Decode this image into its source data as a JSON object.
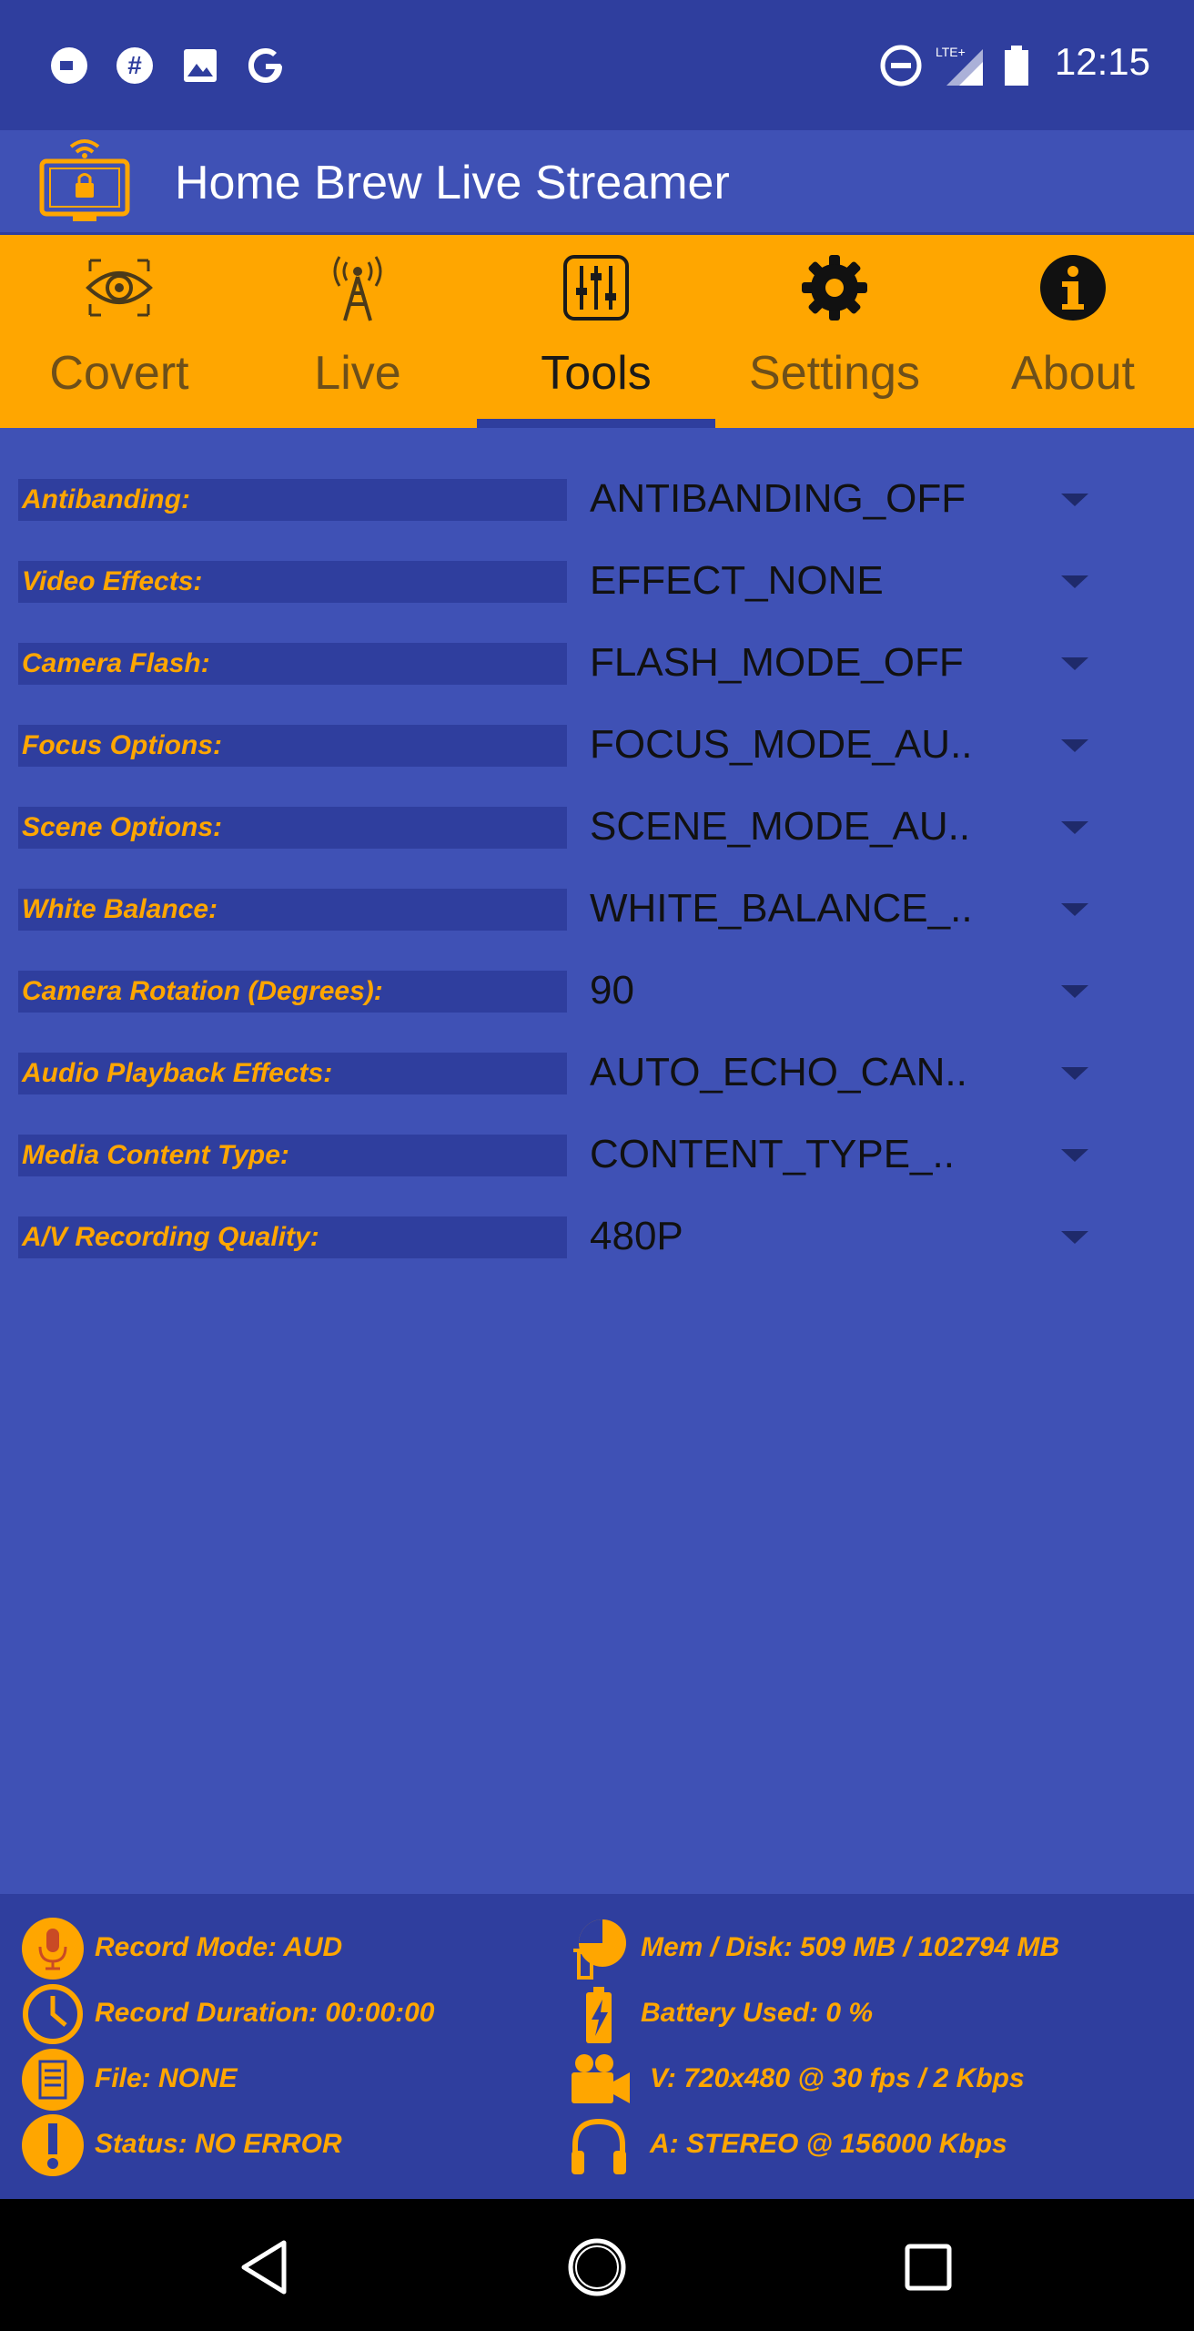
{
  "status_bar": {
    "time": "12:15",
    "left_icons": [
      "dot-circle-icon",
      "slack-icon",
      "image-icon",
      "google-icon"
    ],
    "right_icons": [
      "dnd-icon",
      "signal-lte-icon",
      "battery-icon"
    ],
    "network_label": "LTE+"
  },
  "app_bar": {
    "title": "Home Brew Live Streamer",
    "logo_icon": "tv-lock-wifi-icon"
  },
  "tabs": [
    {
      "label": "Covert",
      "icon": "eye-icon"
    },
    {
      "label": "Live",
      "icon": "antenna-icon"
    },
    {
      "label": "Tools",
      "icon": "sliders-icon",
      "active": true
    },
    {
      "label": "Settings",
      "icon": "gear-icon"
    },
    {
      "label": "About",
      "icon": "info-icon"
    }
  ],
  "settings": [
    {
      "label": "Antibanding:",
      "value": "ANTIBANDING_OFF"
    },
    {
      "label": "Video Effects:",
      "value": "EFFECT_NONE"
    },
    {
      "label": "Camera Flash:",
      "value": "FLASH_MODE_OFF"
    },
    {
      "label": "Focus Options:",
      "value": "FOCUS_MODE_AU.."
    },
    {
      "label": "Scene Options:",
      "value": "SCENE_MODE_AU.."
    },
    {
      "label": "White Balance:",
      "value": "WHITE_BALANCE_.."
    },
    {
      "label": "Camera Rotation (Degrees):",
      "value": "90"
    },
    {
      "label": "Audio Playback Effects:",
      "value": "AUTO_ECHO_CAN.."
    },
    {
      "label": "Media Content Type:",
      "value": "CONTENT_TYPE_.."
    },
    {
      "label": "A/V Recording Quality:",
      "value": "480P"
    }
  ],
  "info": {
    "left": [
      {
        "text": "Record Mode: AUD",
        "icon": "microphone-icon"
      },
      {
        "text": "Record Duration: 00:00:00",
        "icon": "clock-icon"
      },
      {
        "text": "File: NONE",
        "icon": "document-icon"
      },
      {
        "text": "Status: NO ERROR",
        "icon": "exclamation-icon"
      }
    ],
    "right": [
      {
        "text": "Mem / Disk: 509 MB / 102794 MB",
        "icon": "pie-chart-icon"
      },
      {
        "text": "Battery Used: 0 %",
        "icon": "battery-charging-icon"
      },
      {
        "text": "V: 720x480 @ 30 fps / 2 Kbps",
        "icon": "video-camera-icon"
      },
      {
        "text": "A: STEREO @ 156000 Kbps",
        "icon": "headphones-icon"
      }
    ]
  },
  "colors": {
    "primary": "#3f51b5",
    "primary_dark": "#2f3e9e",
    "accent": "#ffa600"
  }
}
